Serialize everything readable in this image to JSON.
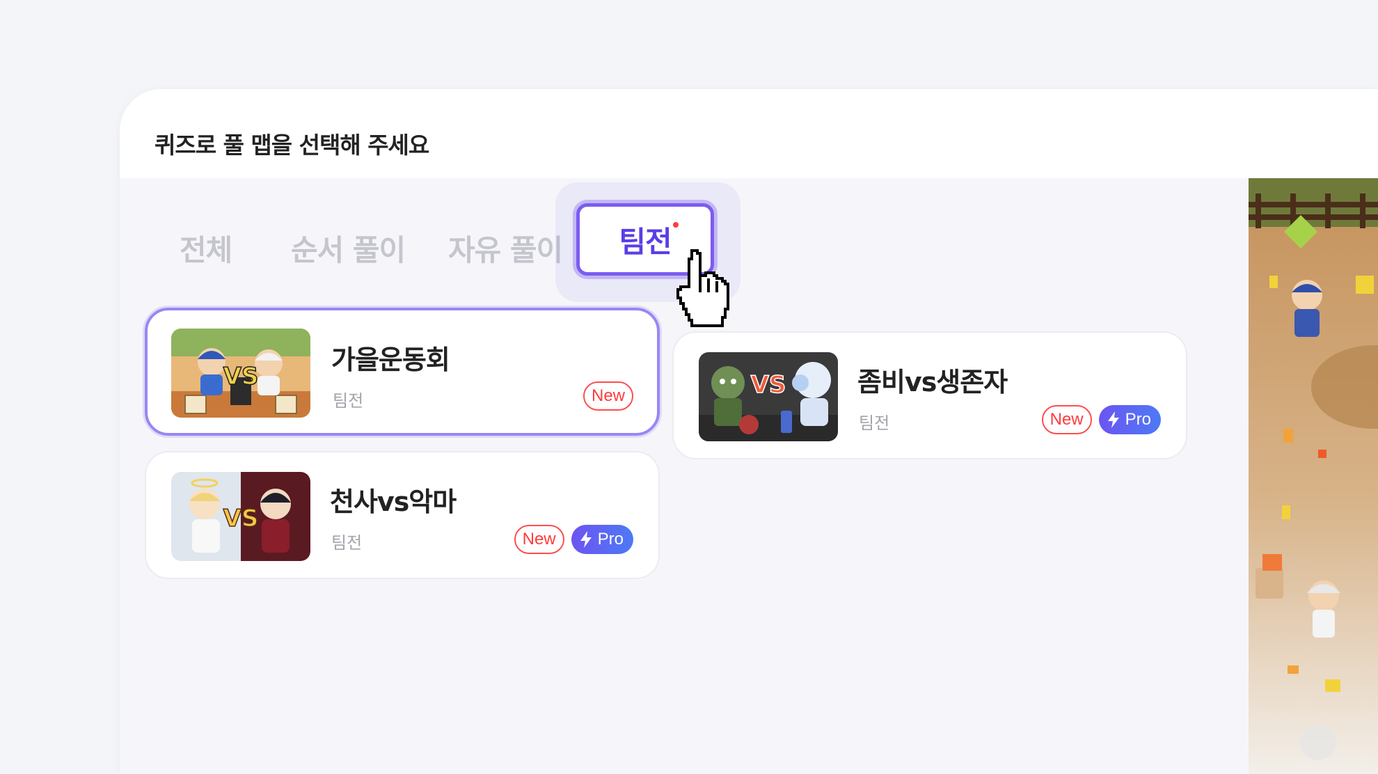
{
  "dialog": {
    "title": "퀴즈로 풀 맵을 선택해 주세요"
  },
  "tabs": [
    {
      "label": "전체",
      "active": false
    },
    {
      "label": "순서 풀이",
      "active": false
    },
    {
      "label": "자유 풀이",
      "active": false
    },
    {
      "label": "팀전",
      "active": true,
      "has_new_dot": true
    }
  ],
  "maps": [
    {
      "name": "가을운동회",
      "type": "팀전",
      "badges": [
        "New"
      ],
      "selected": true,
      "thumbnail_text": "VS"
    },
    {
      "name": "좀비vs생존자",
      "type": "팀전",
      "badges": [
        "New",
        "Pro"
      ],
      "selected": false,
      "thumbnail_text": "VS"
    },
    {
      "name": "천사vs악마",
      "type": "팀전",
      "badges": [
        "New",
        "Pro"
      ],
      "selected": false,
      "thumbnail_text": "VS"
    }
  ],
  "badge_labels": {
    "new": "New",
    "pro": "Pro"
  },
  "colors": {
    "accent": "#7b5cf0",
    "new_badge": "#ff3b3b",
    "pro_badge_start": "#6d54f2",
    "pro_badge_end": "#4d7af5"
  },
  "icons": {
    "pro": "lightning-icon",
    "cursor": "hand-pointer-icon"
  }
}
